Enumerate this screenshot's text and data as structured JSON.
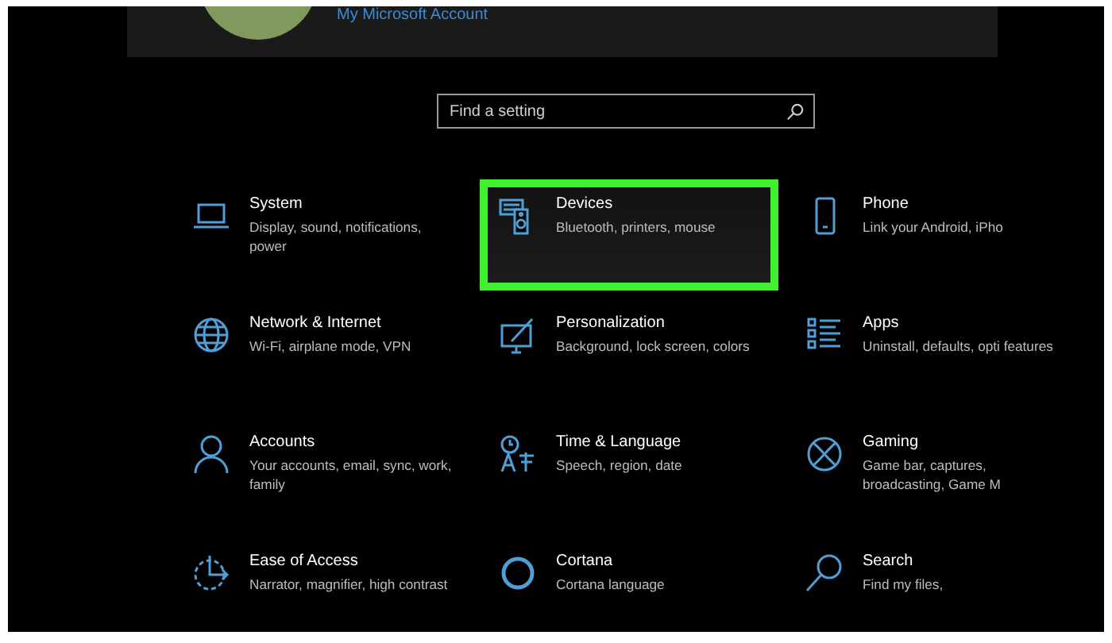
{
  "account": {
    "link": "My Microsoft Account"
  },
  "search": {
    "placeholder": "Find a setting"
  },
  "categories": [
    {
      "title": "System",
      "description": "Display, sound, notifications, power",
      "selected": false
    },
    {
      "title": "Devices",
      "description": "Bluetooth, printers, mouse",
      "selected": true
    },
    {
      "title": "Phone",
      "description": "Link your Android, iPho",
      "selected": false
    },
    {
      "title": "Network & Internet",
      "description": "Wi-Fi, airplane mode, VPN",
      "selected": false
    },
    {
      "title": "Personalization",
      "description": "Background, lock screen, colors",
      "selected": false
    },
    {
      "title": "Apps",
      "description": "Uninstall, defaults, opti features",
      "selected": false
    },
    {
      "title": "Accounts",
      "description": "Your accounts, email, sync, work, family",
      "selected": false
    },
    {
      "title": "Time & Language",
      "description": "Speech, region, date",
      "selected": false
    },
    {
      "title": "Gaming",
      "description": "Game bar, captures, broadcasting, Game M",
      "selected": false
    },
    {
      "title": "Ease of Access",
      "description": "Narrator, magnifier, high contrast",
      "selected": false
    },
    {
      "title": "Cortana",
      "description": "Cortana language",
      "selected": false
    },
    {
      "title": "Search",
      "description": "Find my files,",
      "selected": false
    }
  ]
}
